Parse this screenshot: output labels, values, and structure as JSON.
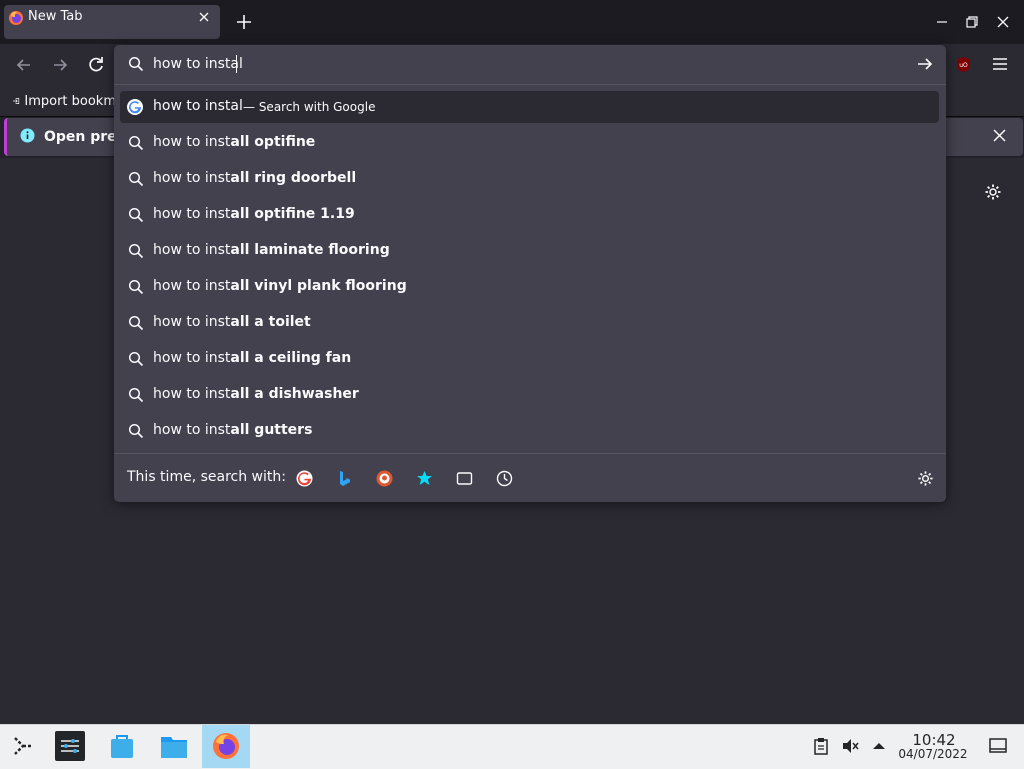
{
  "tab": {
    "title": "New Tab"
  },
  "bookmarks_bar": {
    "import_label": "Import bookm"
  },
  "notification": {
    "text": "Open previ"
  },
  "urlbar": {
    "value": "how to instal",
    "heuristic": {
      "text": "how to instal",
      "action": "— Search with Google"
    },
    "suggestions": [
      {
        "typed": "how to inst",
        "completion": "all optifine"
      },
      {
        "typed": "how to inst",
        "completion": "all ring doorbell"
      },
      {
        "typed": "how to inst",
        "completion": "all optifine 1.19"
      },
      {
        "typed": "how to inst",
        "completion": "all laminate flooring"
      },
      {
        "typed": "how to inst",
        "completion": "all vinyl plank flooring"
      },
      {
        "typed": "how to inst",
        "completion": "all a to",
        "tail": "ilet"
      },
      {
        "typed": "how to inst",
        "completion": "all a ceiling fan"
      },
      {
        "typed": "how to inst",
        "completion": "all a dishwasher"
      },
      {
        "typed": "how to inst",
        "completion": "all gutters"
      }
    ],
    "one_off_label": "This time, search with:",
    "one_off_engines": [
      "google",
      "bing",
      "duckduckgo",
      "bookmarks",
      "tabs",
      "history"
    ]
  },
  "taskbar": {
    "time": "10:42",
    "date": "04/07/2022"
  },
  "colors": {
    "accent": "#00ddff",
    "ublock": "#800000",
    "notice_border": "#c13fd8"
  }
}
